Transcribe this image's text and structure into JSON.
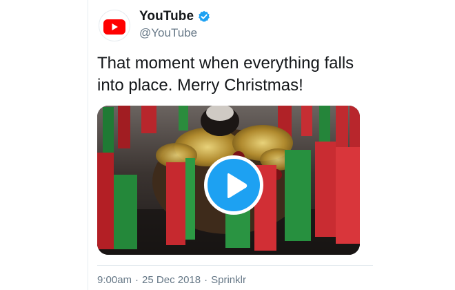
{
  "tweet": {
    "display_name": "YouTube",
    "handle": "@YouTube",
    "verified": true,
    "text": "That moment when everything falls into place. Merry Christmas!",
    "media": {
      "type": "video",
      "play_icon": "play-icon"
    },
    "time": "9:00am",
    "date": "25 Dec 2018",
    "source": "Sprinklr",
    "separator": "·"
  },
  "colors": {
    "verified_blue": "#1da1f2",
    "youtube_red": "#ff0000",
    "text": "#14171a",
    "secondary_text": "#657786"
  }
}
